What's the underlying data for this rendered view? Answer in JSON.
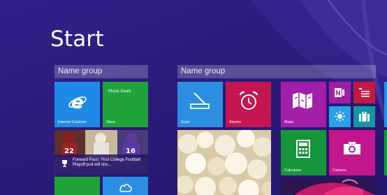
{
  "start": {
    "title": "Start"
  },
  "groups": [
    {
      "label": "Name group"
    },
    {
      "label": "Name group"
    }
  ],
  "tiles": {
    "internet_explorer": {
      "label": "Internet Explorer",
      "color": "#1e8ae6"
    },
    "store": {
      "top_text": "Music Deals",
      "label": "Store",
      "color": "#1fa33a"
    },
    "news": {
      "caption": "Forward Pass: First College Football Playoff poll will sho..."
    },
    "scan": {
      "label": "Scan",
      "color": "#2a8fe3"
    },
    "alarms": {
      "label": "Alarms",
      "color": "#c4164f"
    },
    "maps": {
      "label": "Maps",
      "color": "#a31ea8"
    },
    "onenote": {
      "color": "#a31ea8"
    },
    "reading_list": {
      "color": "#c41a3e"
    },
    "weather": {
      "color": "#2aa0e8"
    },
    "travel": {
      "color": "#1296a8"
    },
    "calculator": {
      "label": "Calculator",
      "color": "#16953a"
    },
    "camera": {
      "label": "Camera",
      "color": "#c4168c"
    }
  },
  "theme": {
    "background": "#2b1a7a",
    "group_header": "#4e3e96"
  }
}
